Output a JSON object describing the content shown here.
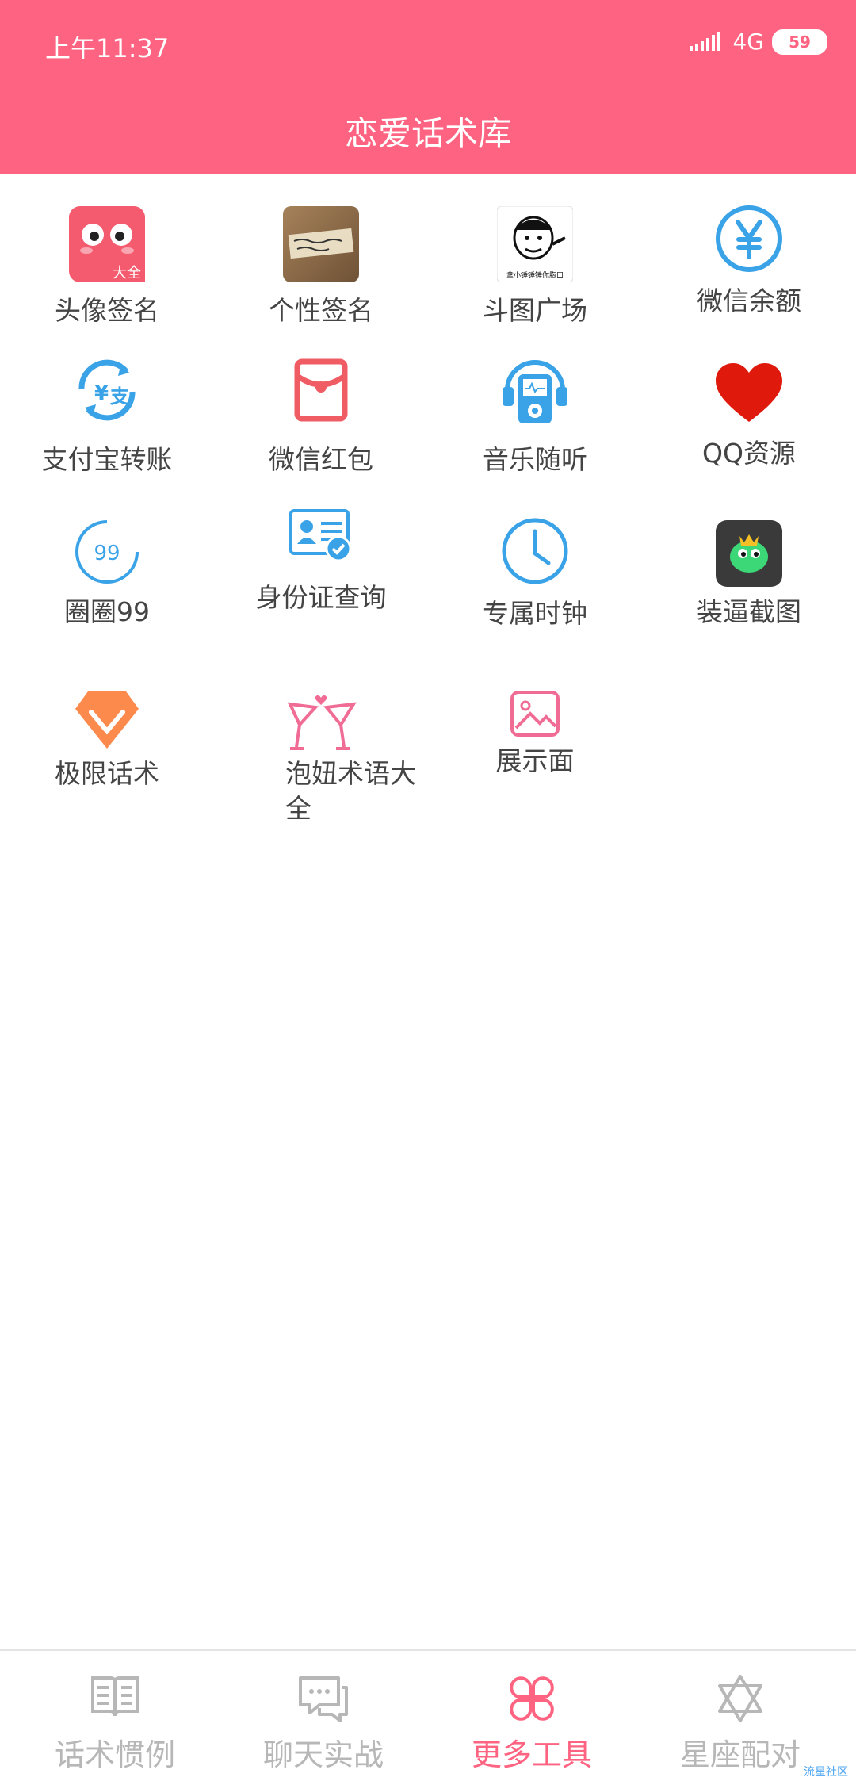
{
  "status": {
    "time": "上午11:37",
    "network": "4G",
    "battery": "59"
  },
  "header": {
    "title": "恋爱话术库"
  },
  "tools": [
    {
      "label": "头像签名",
      "icon": "avatar-face-icon",
      "badge": "大全"
    },
    {
      "label": "个性签名",
      "icon": "handwriting-photo-icon"
    },
    {
      "label": "斗图广场",
      "icon": "meme-face-icon",
      "caption": "拿小锤锤锤你胸口"
    },
    {
      "label": "微信余额",
      "icon": "yuan-circle-icon"
    },
    {
      "label": "支付宝转账",
      "icon": "alipay-transfer-icon"
    },
    {
      "label": "微信红包",
      "icon": "red-envelope-icon"
    },
    {
      "label": "音乐随听",
      "icon": "music-player-icon"
    },
    {
      "label": "QQ资源",
      "icon": "heart-icon"
    },
    {
      "label": "圈圈99",
      "icon": "circle-99-icon",
      "badge": "99"
    },
    {
      "label": "身份证查询",
      "icon": "id-card-icon"
    },
    {
      "label": "专属时钟",
      "icon": "clock-icon"
    },
    {
      "label": "装逼截图",
      "icon": "green-monster-icon"
    },
    {
      "label": "极限话术",
      "icon": "diamond-icon"
    },
    {
      "label": "泡妞术语大全",
      "icon": "cocktail-icon"
    },
    {
      "label": "展示面",
      "icon": "picture-icon"
    }
  ],
  "tabs": [
    {
      "label": "话术惯例",
      "icon": "book-icon",
      "active": false
    },
    {
      "label": "聊天实战",
      "icon": "chat-bubble-icon",
      "active": false
    },
    {
      "label": "更多工具",
      "icon": "four-leaf-icon",
      "active": true
    },
    {
      "label": "星座配对",
      "icon": "star-of-david-icon",
      "active": false
    }
  ],
  "colors": {
    "brand": "#fe6481",
    "inactive": "#b7b7b7",
    "blue": "#3aa3e8"
  },
  "watermark": "流星社区"
}
